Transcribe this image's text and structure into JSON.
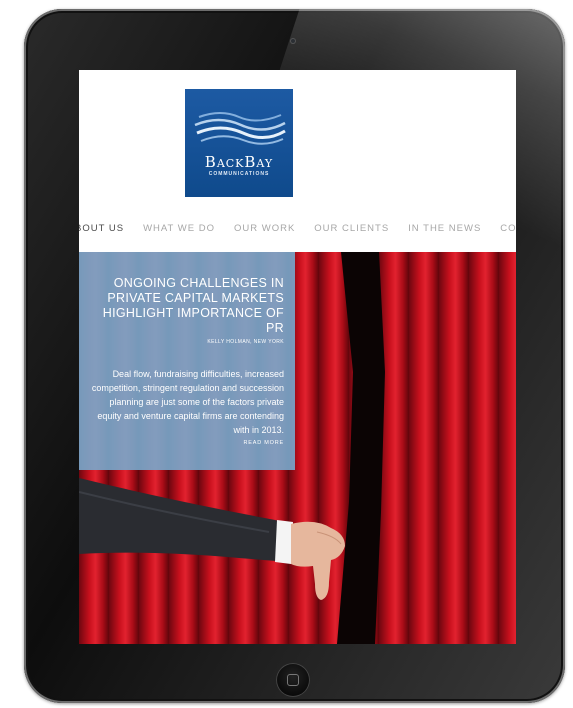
{
  "brand": {
    "name": "BackBay",
    "tagline": "COMMUNICATIONS",
    "logo_color": "#1557a0"
  },
  "nav": {
    "items": [
      {
        "label": "BOUT US",
        "active": true
      },
      {
        "label": "WHAT WE DO",
        "active": false
      },
      {
        "label": "OUR WORK",
        "active": false
      },
      {
        "label": "OUR CLIENTS",
        "active": false
      },
      {
        "label": "IN THE NEWS",
        "active": false
      },
      {
        "label": "CONT",
        "active": false
      }
    ]
  },
  "feature": {
    "headline": "ONGOING CHALLENGES IN PRIVATE CAPITAL MARKETS HIGHLIGHT IMPORTANCE OF PR",
    "byline": "KELLY HOLMAN, NEW YORK",
    "summary": "Deal flow, fundraising difficulties, increased competition, stringent regulation and succession planning are just some of the factors private equity and venture capital firms are contending with in 2013.",
    "read_more": "READ MORE",
    "overlay_color": "#78aacd"
  },
  "colors": {
    "curtain": "#b30d18",
    "device": "#111111"
  }
}
